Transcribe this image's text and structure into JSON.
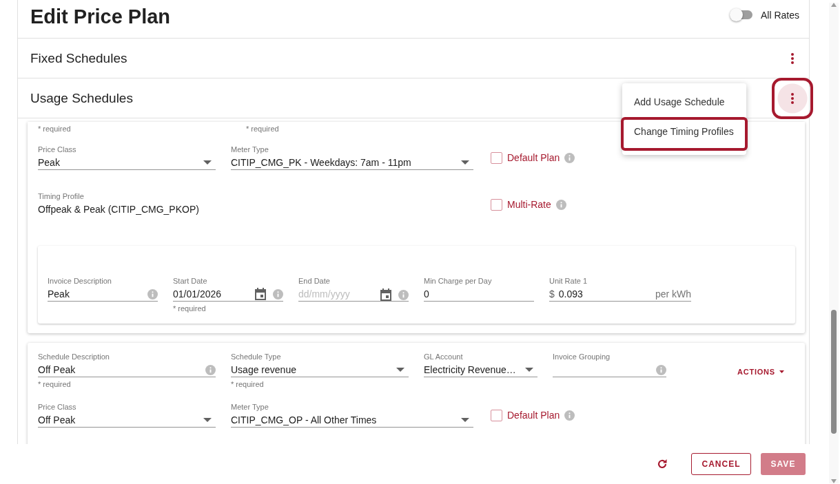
{
  "page": {
    "title": "Edit Price Plan",
    "all_rates_toggle": {
      "label": "All Rates",
      "on": false
    }
  },
  "sections": [
    {
      "title": "Fixed Schedules",
      "highlighted": false
    },
    {
      "title": "Usage Schedules",
      "highlighted": true
    }
  ],
  "menu": {
    "items": [
      {
        "label": "Add Usage Schedule",
        "highlighted": false
      },
      {
        "label": "Change Timing Profiles",
        "highlighted": true
      }
    ]
  },
  "schedules": [
    {
      "required_hints": [
        "* required",
        "* required"
      ],
      "price_class": {
        "label": "Price Class",
        "value": "Peak"
      },
      "meter_type": {
        "label": "Meter Type",
        "value": "CITIP_CMG_PK - Weekdays: 7am - 11pm"
      },
      "default_plan": {
        "label": "Default Plan",
        "checked": false
      },
      "timing_profile": {
        "label": "Timing Profile",
        "value": "Offpeak & Peak (CITIP_CMG_PKOP)"
      },
      "multi_rate": {
        "label": "Multi-Rate",
        "checked": false
      },
      "rate": {
        "invoice_description": {
          "label": "Invoice Description",
          "value": "Peak"
        },
        "start_date": {
          "label": "Start Date",
          "value": "01/01/2026",
          "hint": "* required"
        },
        "end_date": {
          "label": "End Date",
          "placeholder": "dd/mm/yyyy"
        },
        "min_charge": {
          "label": "Min Charge per Day",
          "value": "0"
        },
        "unit_rate": {
          "label": "Unit Rate 1",
          "prefix": "$",
          "value": "0.093",
          "suffix": "per kWh"
        }
      }
    },
    {
      "schedule_description": {
        "label": "Schedule Description",
        "value": "Off Peak",
        "hint": "* required"
      },
      "schedule_type": {
        "label": "Schedule Type",
        "value": "Usage revenue",
        "hint": "* required"
      },
      "gl_account": {
        "label": "GL Account",
        "value": "Electricity Revenue…"
      },
      "invoice_grouping": {
        "label": "Invoice Grouping"
      },
      "actions": "ACTIONS",
      "price_class": {
        "label": "Price Class",
        "value": "Off Peak"
      },
      "meter_type": {
        "label": "Meter Type",
        "value": "CITIP_CMG_OP - All Other Times"
      },
      "default_plan": {
        "label": "Default Plan",
        "checked": false
      }
    }
  ],
  "footer": {
    "cancel": "CANCEL",
    "save": {
      "label": "SAVE",
      "disabled": true
    }
  }
}
